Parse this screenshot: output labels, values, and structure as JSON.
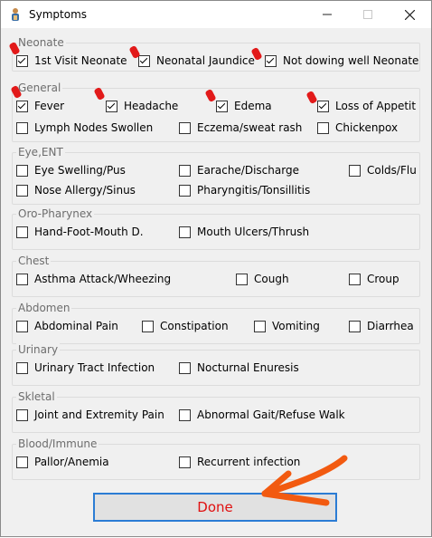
{
  "window": {
    "title": "Symptoms",
    "controls": {
      "minimize": "minimize-icon",
      "maximize": "maximize-icon",
      "close": "close-icon"
    }
  },
  "groups": [
    {
      "label": "Neonate",
      "items": [
        {
          "label": "1st Visit Neonate",
          "checked": true
        },
        {
          "label": "Neonatal Jaundice",
          "checked": true
        },
        {
          "label": "Not dowing well Neonate",
          "checked": true
        }
      ]
    },
    {
      "label": "General",
      "items": [
        {
          "label": "Fever",
          "checked": true
        },
        {
          "label": "Headache",
          "checked": true
        },
        {
          "label": "Edema",
          "checked": true
        },
        {
          "label": "Loss of Appetit",
          "checked": true
        },
        {
          "label": "Lymph Nodes Swollen",
          "checked": false
        },
        {
          "label": "Eczema/sweat rash",
          "checked": false
        },
        {
          "label": "Chickenpox",
          "checked": false
        }
      ]
    },
    {
      "label": "Eye,ENT",
      "items": [
        {
          "label": "Eye Swelling/Pus",
          "checked": false
        },
        {
          "label": "Earache/Discharge",
          "checked": false
        },
        {
          "label": "Colds/Flu",
          "checked": false
        },
        {
          "label": "Nose Allergy/Sinus",
          "checked": false
        },
        {
          "label": "Pharyngitis/Tonsillitis",
          "checked": false
        }
      ]
    },
    {
      "label": "Oro-Pharynex",
      "items": [
        {
          "label": "Hand-Foot-Mouth D.",
          "checked": false
        },
        {
          "label": "Mouth Ulcers/Thrush",
          "checked": false
        }
      ]
    },
    {
      "label": "Chest",
      "items": [
        {
          "label": "Asthma Attack/Wheezing",
          "checked": false
        },
        {
          "label": "Cough",
          "checked": false
        },
        {
          "label": "Croup",
          "checked": false
        }
      ]
    },
    {
      "label": "Abdomen",
      "items": [
        {
          "label": "Abdominal Pain",
          "checked": false
        },
        {
          "label": "Constipation",
          "checked": false
        },
        {
          "label": "Vomiting",
          "checked": false
        },
        {
          "label": "Diarrhea",
          "checked": false
        }
      ]
    },
    {
      "label": "Urinary",
      "items": [
        {
          "label": "Urinary Tract Infection",
          "checked": false
        },
        {
          "label": "Nocturnal Enuresis",
          "checked": false
        }
      ]
    },
    {
      "label": "Skletal",
      "items": [
        {
          "label": "Joint and Extremity Pain",
          "checked": false
        },
        {
          "label": "Abnormal Gait/Refuse Walk",
          "checked": false
        }
      ]
    },
    {
      "label": "Blood/Immune",
      "items": [
        {
          "label": "Pallor/Anemia",
          "checked": false
        },
        {
          "label": "Recurrent infection",
          "checked": false
        }
      ]
    }
  ],
  "done_button": {
    "label": "Done"
  },
  "annotation_colors": {
    "marker": "#e21a1a",
    "arrow": "#f25a10",
    "done_text": "#e01010",
    "focus_border": "#2b7cd4"
  }
}
